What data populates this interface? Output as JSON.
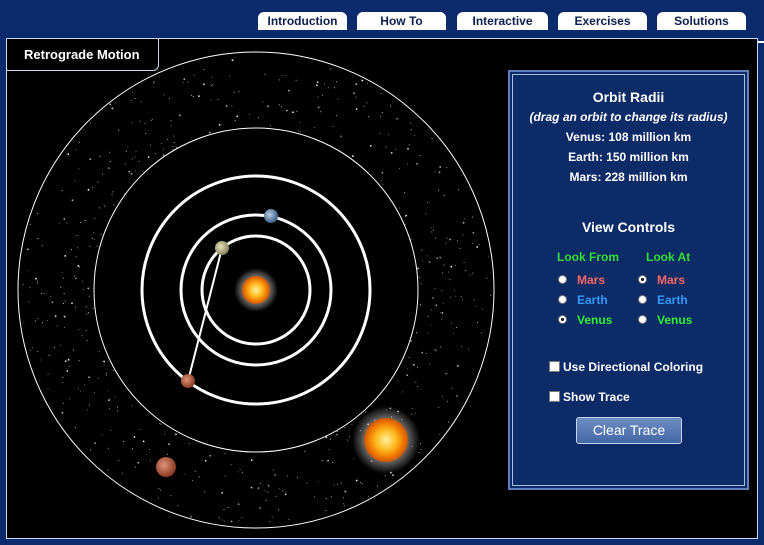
{
  "tabs": [
    {
      "label": "Introduction"
    },
    {
      "label": "How To"
    },
    {
      "label": "Interactive"
    },
    {
      "label": "Exercises"
    },
    {
      "label": "Solutions"
    }
  ],
  "active_tab": "Interactive",
  "title": "Retrograde Motion",
  "panel": {
    "orbit_title": "Orbit Radii",
    "orbit_subtitle": "(drag an orbit to change its radius)",
    "venus_line": "Venus: 108 million km",
    "earth_line": "Earth: 150 million km",
    "mars_line": "Mars: 228 million km",
    "view_title": "View Controls",
    "look_from_label": "Look From",
    "look_at_label": "Look At",
    "look_from": {
      "mars": "Mars",
      "earth": "Earth",
      "venus": "Venus",
      "selected": "Venus"
    },
    "look_at": {
      "mars": "Mars",
      "earth": "Earth",
      "venus": "Venus",
      "selected": "Mars"
    },
    "directional_label": "Use Directional Coloring",
    "trace_label": "Show Trace",
    "clear_label": "Clear Trace"
  },
  "colors": {
    "mars": "#ff6666",
    "earth": "#3399ff",
    "venus": "#33ee33",
    "panel_bg": "#0d2b66",
    "header_bg": "#0b2a6b"
  }
}
